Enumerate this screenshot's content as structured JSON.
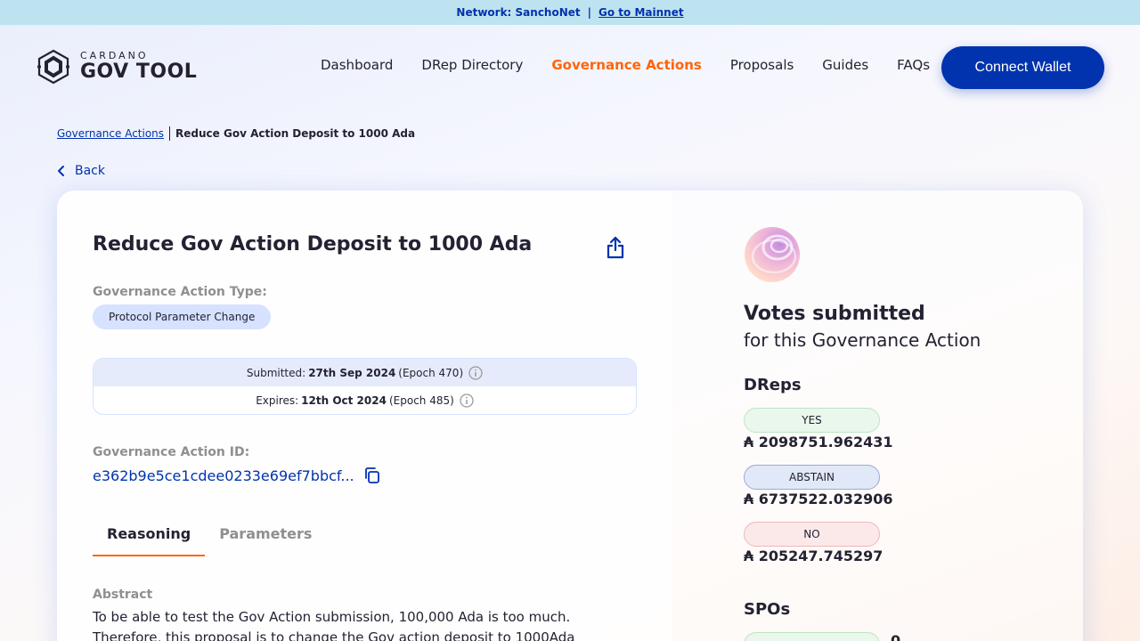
{
  "network_bar": {
    "label": "Network: SanchoNet",
    "separator": "|",
    "link": "Go to Mainnet"
  },
  "logo": {
    "small": "CARDANO",
    "large": "GOV TOOL"
  },
  "nav": {
    "items": [
      {
        "label": "Dashboard"
      },
      {
        "label": "DRep Directory"
      },
      {
        "label": "Governance Actions",
        "active": true
      },
      {
        "label": "Proposals"
      },
      {
        "label": "Guides"
      },
      {
        "label": "FAQs"
      }
    ],
    "connect_label": "Connect Wallet"
  },
  "breadcrumb": {
    "parent": "Governance Actions",
    "current": "Reduce Gov Action Deposit to 1000 Ada"
  },
  "back_label": "Back",
  "action": {
    "title": "Reduce Gov Action Deposit to 1000 Ada",
    "type_label": "Governance Action Type:",
    "type_value": "Protocol Parameter Change",
    "submitted_prefix": "Submitted:",
    "submitted_date": "27th Sep 2024",
    "submitted_epoch": "(Epoch 470)",
    "expires_prefix": "Expires:",
    "expires_date": "12th Oct 2024",
    "expires_epoch": "(Epoch 485)",
    "id_label": "Governance Action ID:",
    "id_value": "e362b9e5ce1cdee0233e69ef7bbcf...",
    "tabs": [
      {
        "label": "Reasoning",
        "active": true
      },
      {
        "label": "Parameters"
      }
    ],
    "abstract_label": "Abstract",
    "abstract_text": "To be able to test the Gov Action submission, 100,000 Ada is too much. Therefore, this proposal is to change the Gov action deposit to 1000Ada"
  },
  "votes": {
    "title": "Votes submitted",
    "subtitle": "for this Governance Action",
    "dreps_label": "DReps",
    "dreps": [
      {
        "label": "YES",
        "value": "₳ 2098751.962431"
      },
      {
        "label": "ABSTAIN",
        "value": "₳ 6737522.032906"
      },
      {
        "label": "NO",
        "value": "₳ 205247.745297"
      }
    ],
    "spos_label": "SPOs",
    "spos_yes_value": "0"
  },
  "colors": {
    "primary": "#0033ad",
    "accent": "#ff640a",
    "netbar": "#bee3f0"
  }
}
